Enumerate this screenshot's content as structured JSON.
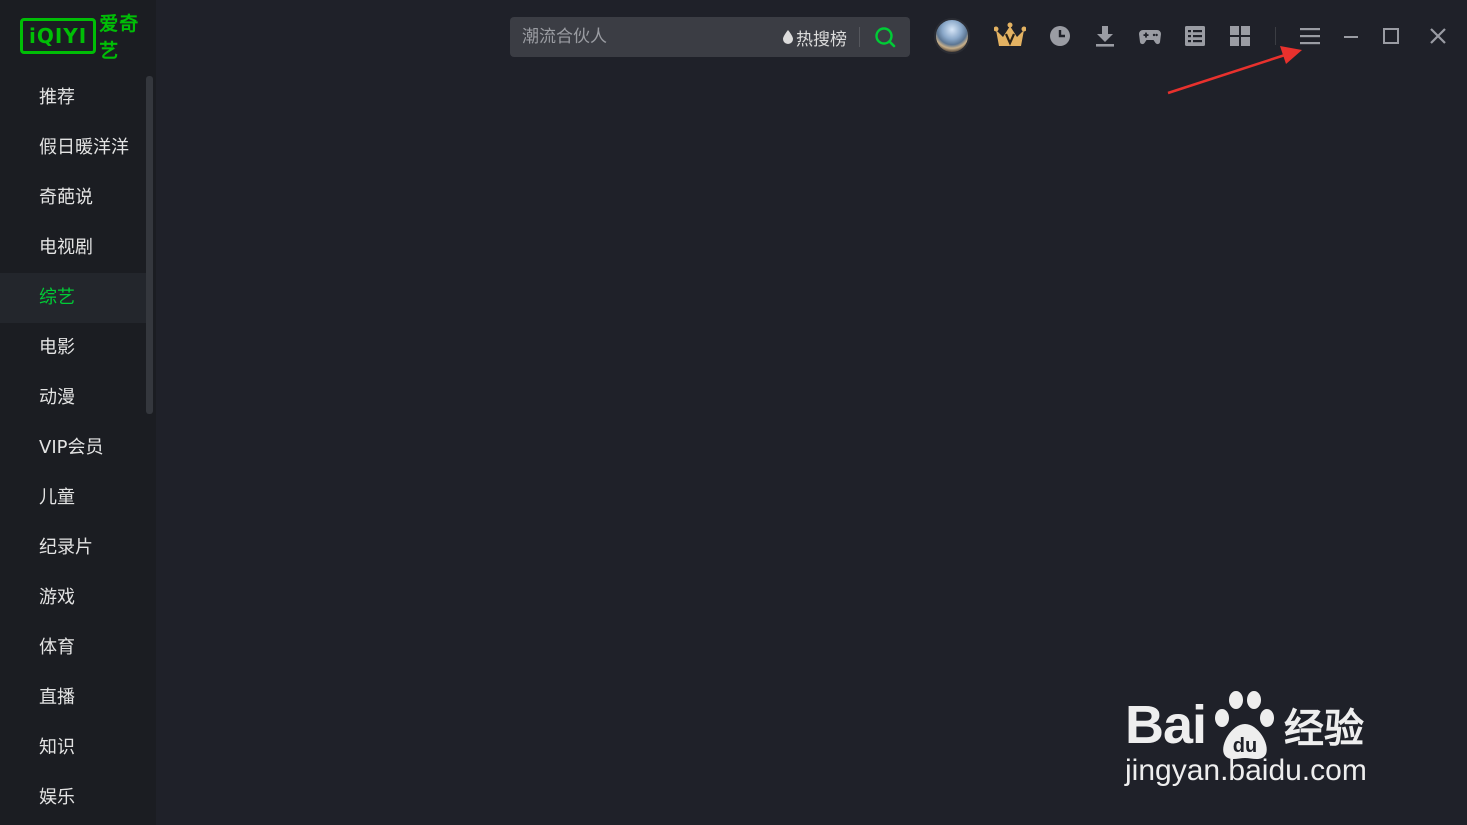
{
  "app": {
    "logo_text": "iQIYI",
    "logo_name": "爱奇艺",
    "brand_color": "#00be06"
  },
  "sidebar": {
    "items": [
      {
        "label": "推荐"
      },
      {
        "label": "假日暖洋洋"
      },
      {
        "label": "奇葩说"
      },
      {
        "label": "电视剧"
      },
      {
        "label": "综艺",
        "active": true
      },
      {
        "label": "电影"
      },
      {
        "label": "动漫"
      },
      {
        "label": "VIP会员"
      },
      {
        "label": "儿童"
      },
      {
        "label": "纪录片"
      },
      {
        "label": "游戏"
      },
      {
        "label": "体育"
      },
      {
        "label": "直播"
      },
      {
        "label": "知识"
      },
      {
        "label": "娱乐"
      }
    ]
  },
  "search": {
    "placeholder": "潮流合伙人",
    "hot_label": "热搜榜"
  },
  "toolbar": {
    "icons": [
      "avatar",
      "vip-crown-icon",
      "history-icon",
      "download-icon",
      "gamepad-icon",
      "list-icon",
      "apps-grid-icon",
      "menu-icon",
      "minimize-icon",
      "maximize-icon",
      "close-icon"
    ]
  },
  "watermark": {
    "brand_left": "Bai",
    "brand_right": "经验",
    "url": "jingyan.baidu.com"
  }
}
